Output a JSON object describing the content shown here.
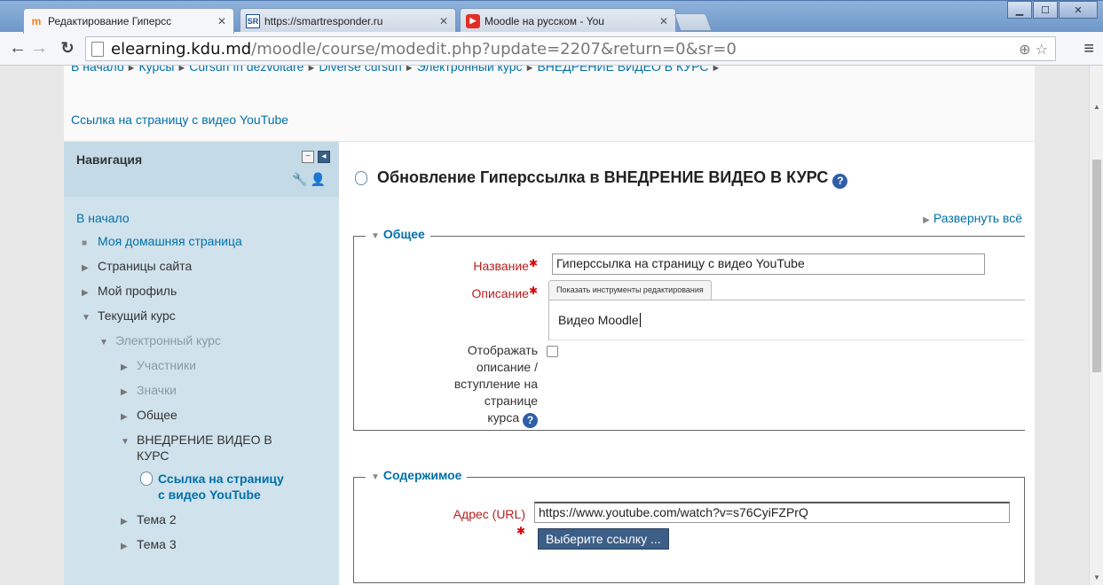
{
  "browser": {
    "tabs": [
      {
        "title": "Редактирование Гиперсс",
        "favicon": "moodle-logo",
        "active": true
      },
      {
        "title": "https://smartresponder.ru",
        "favicon": "sr-logo",
        "active": false
      },
      {
        "title": "Moodle на русском - You",
        "favicon": "youtube-logo",
        "active": false
      }
    ],
    "url_host": "elearning.kdu.md",
    "url_path": "/moodle/course/modedit.php?update=2207&return=0&sr=0"
  },
  "breadcrumb": {
    "row1": [
      "В начало",
      "Курсы",
      "Cursuri în dezvoltare",
      "Diverse cursuri",
      "Электронный курс",
      "ВНЕДРЕНИЕ ВИДЕО В КУРС"
    ],
    "row2": "Ссылка на страницу с видео YouTube",
    "separator": "►"
  },
  "sidebar": {
    "title": "Навигация",
    "home": "В начало",
    "my_home": "Моя домашняя страница",
    "site_pages": "Страницы сайта",
    "my_profile": "Мой профиль",
    "current_course": "Текущий курс",
    "course": "Электронный курс",
    "participants": "Участники",
    "badges": "Значки",
    "general": "Общее",
    "section_line1": "ВНЕДРЕНИЕ ВИДЕО В",
    "section_line2": "КУРС",
    "active_line1": "Ссылка на страницу",
    "active_line2": "с видео YouTube",
    "topic2": "Тема 2",
    "topic3": "Тема 3"
  },
  "main": {
    "heading": "Обновление Гиперссылка в ВНЕДРЕНИЕ ВИДЕО В КУРС",
    "expand_all": "Развернуть всё",
    "general_legend": "Общее",
    "name_label": "Название",
    "name_value": "Гиперссылка на страницу с видео YouTube",
    "description_label": "Описание",
    "editor_toggle": "Показать инструменты редактирования",
    "description_value": "Видео Moodle",
    "show_desc_line1": "Отображать",
    "show_desc_line2": "описание /",
    "show_desc_line3": "вступление на",
    "show_desc_line4": "странице",
    "show_desc_line5": "курса",
    "content_legend": "Содержимое",
    "url_label": "Адрес (URL)",
    "url_value": "https://www.youtube.com/watch?v=s76CyiFZPrQ",
    "pick_link": "Выберите ссылку ..."
  }
}
